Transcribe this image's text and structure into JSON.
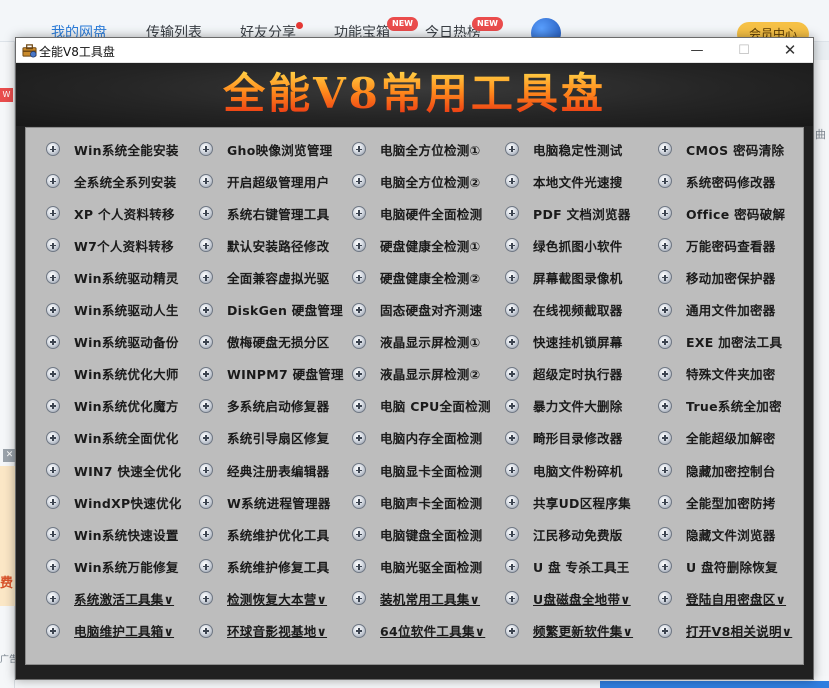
{
  "background": {
    "tabs": [
      {
        "label": "我的网盘"
      },
      {
        "label": "传输列表"
      },
      {
        "label": "好友分享"
      },
      {
        "label": "功能宝箱"
      },
      {
        "label": "今日热榜"
      }
    ],
    "new_badge": "NEW",
    "vip_label": "会员中心",
    "left_badge": "W",
    "left_close": "✕",
    "left_ad_text": "费",
    "left_footer": "广告",
    "right_text": "曲"
  },
  "window": {
    "title": "全能V8工具盘",
    "minimize": "—",
    "maximize": "☐",
    "close": "✕",
    "banner": "全能V8常用工具盘"
  },
  "grid": {
    "columns": [
      [
        "Win系统全能安装",
        "全系统全系列安装",
        "XP 个人资料转移",
        "W7个人资料转移",
        "Win系统驱动精灵",
        "Win系统驱动人生",
        "Win系统驱动备份",
        "Win系统优化大师",
        "Win系统优化魔方",
        "Win系统全面优化",
        "WIN7 快速全优化",
        "WindXP快速优化",
        "Win系统快速设置",
        "Win系统万能修复",
        "系统激活工具集∨",
        "电脑维护工具箱∨"
      ],
      [
        "Gho映像浏览管理",
        "开启超级管理用户",
        "系统右键管理工具",
        "默认安装路径修改",
        "全面兼容虚拟光驱",
        "DiskGen 硬盘管理",
        "傲梅硬盘无损分区",
        "WINPM7 硬盘管理",
        "多系统启动修复器",
        "系统引导扇区修复",
        "经典注册表编辑器",
        "W系统进程管理器",
        "系统维护优化工具",
        "系统维护修复工具",
        "检测恢复大本营∨",
        "环球音影视基地∨"
      ],
      [
        "电脑全方位检测①",
        "电脑全方位检测②",
        "电脑硬件全面检测",
        "硬盘健康全检测①",
        "硬盘健康全检测②",
        "固态硬盘对齐测速",
        "液晶显示屏检测①",
        "液晶显示屏检测②",
        "电脑 CPU全面检测",
        "电脑内存全面检测",
        "电脑显卡全面检测",
        "电脑声卡全面检测",
        "电脑键盘全面检测",
        "电脑光驱全面检测",
        "装机常用工具集∨",
        "64位软件工具集∨"
      ],
      [
        "电脑稳定性测试",
        "本地文件光速搜",
        "PDF 文档浏览器",
        "绿色抓图小软件",
        "屏幕截图录像机",
        "在线视频截取器",
        "快速挂机锁屏幕",
        "超级定时执行器",
        "暴力文件大删除",
        "畸形目录修改器",
        "电脑文件粉碎机",
        "共享UD区程序集",
        "江民移动免费版",
        "U 盘 专杀工具王",
        "U盘磁盘全地带∨",
        "频繁更新软件集∨"
      ],
      [
        "CMOS 密码清除",
        "系统密码修改器",
        "Office 密码破解",
        "万能密码查看器",
        "移动加密保护器",
        "通用文件加密器",
        "EXE 加密法工具",
        "特殊文件夹加密",
        "True系统全加密",
        "全能超级加解密",
        "隐藏加密控制台",
        "全能型加密防拷",
        "隐藏文件浏览器",
        "U 盘符删除恢复",
        "登陆自用密盘区∨",
        "打开V8相关说明∨"
      ]
    ]
  }
}
